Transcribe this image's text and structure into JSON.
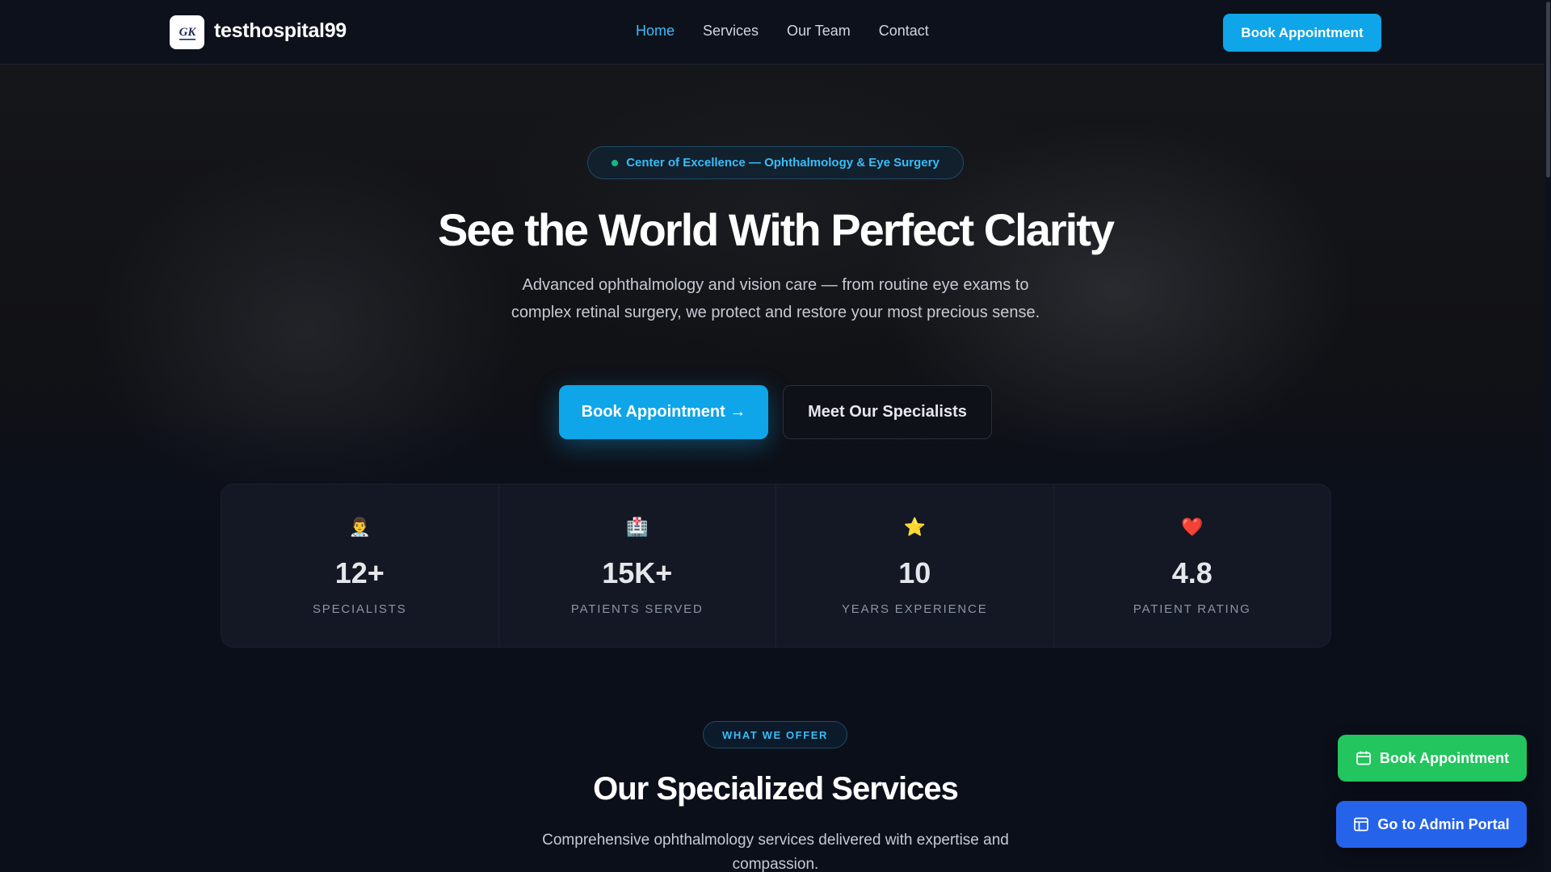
{
  "header": {
    "brand": "testhospital99",
    "nav": [
      "Home",
      "Services",
      "Our Team",
      "Contact"
    ],
    "active_nav": "Home",
    "cta": "Book Appointment"
  },
  "hero": {
    "badge": "Center of Excellence — Ophthalmology & Eye Surgery",
    "title": "See the World With Perfect Clarity",
    "subtitle": "Advanced ophthalmology and vision care — from routine eye exams to complex retinal surgery, we protect and restore your most precious sense.",
    "primary_button": "Book Appointment →",
    "secondary_button": "Meet Our Specialists"
  },
  "stats": [
    {
      "icon": "👨‍⚕️",
      "icon_name": "doctor-icon",
      "value": "12+",
      "label": "SPECIALISTS"
    },
    {
      "icon": "🏥",
      "icon_name": "hospital-icon",
      "value": "15K+",
      "label": "PATIENTS SERVED"
    },
    {
      "icon": "⭐",
      "icon_name": "star-icon",
      "value": "10",
      "label": "YEARS EXPERIENCE"
    },
    {
      "icon": "❤️",
      "icon_name": "heart-icon",
      "value": "4.8",
      "label": "PATIENT RATING"
    }
  ],
  "services": {
    "pill": "WHAT WE OFFER",
    "title": "Our Specialized Services",
    "subtitle": "Comprehensive ophthalmology services delivered with expertise and compassion."
  },
  "floating": {
    "book": "Book Appointment",
    "admin": "Go to Admin Portal"
  },
  "colors": {
    "accent": "#0ea5e9",
    "green": "#22c55e",
    "blue": "#2563eb",
    "background": "#0b0f1a"
  }
}
